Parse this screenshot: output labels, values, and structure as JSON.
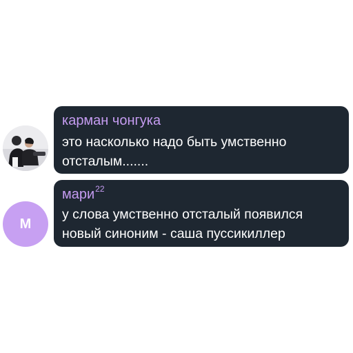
{
  "messages": [
    {
      "sender": "карман чонгука",
      "sender_superscript": "",
      "text": "это насколько надо быть умственно\nотсталым.......",
      "avatar": {
        "type": "photo",
        "icon": "user-photo-icon"
      }
    },
    {
      "sender": "мари",
      "sender_superscript": "22",
      "text": "у слова умственно отсталый появился\nновый синоним - саша пуссикиллер",
      "avatar": {
        "type": "letter",
        "letter": "М",
        "color": "#c7a0f2"
      }
    }
  ],
  "colors": {
    "bubble": "#1e2731",
    "sender_name": "#c59cf1",
    "message_text": "#ffffff",
    "background": "#ffffff"
  }
}
